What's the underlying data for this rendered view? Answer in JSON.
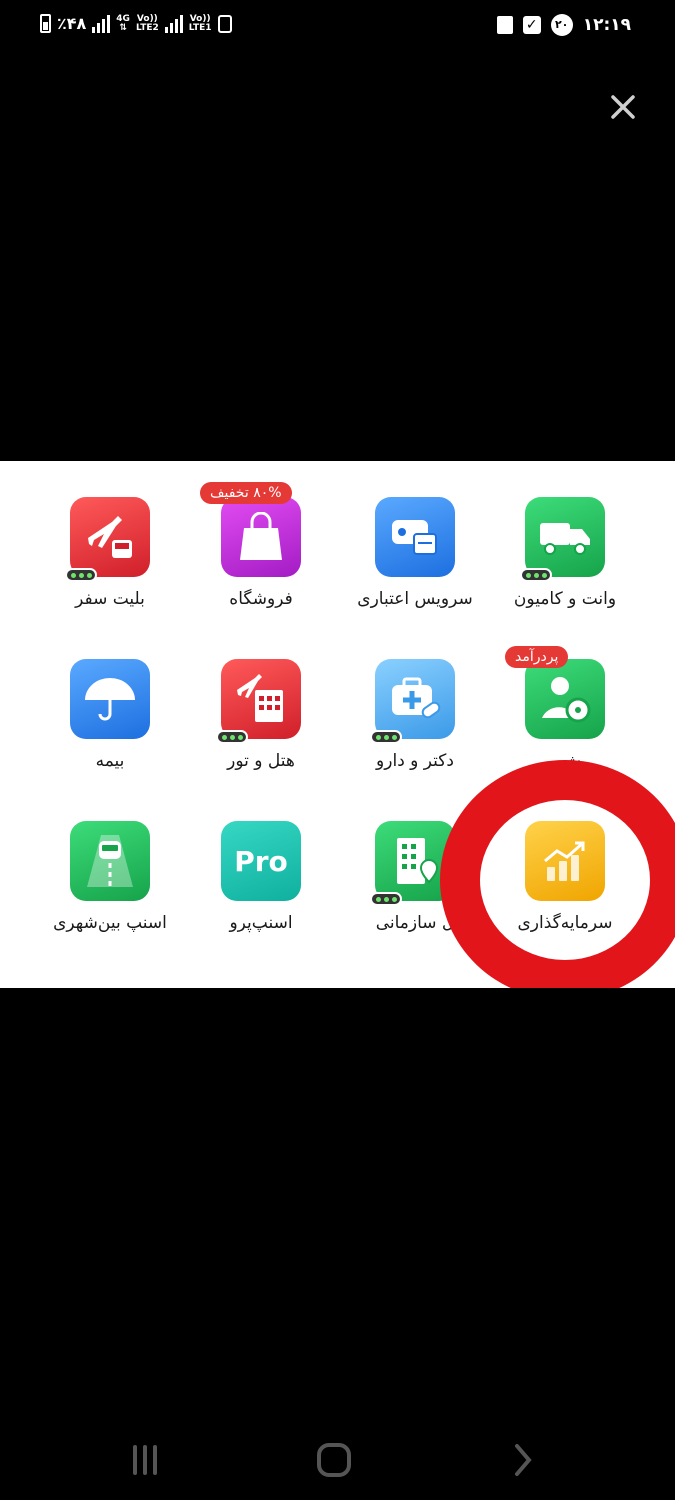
{
  "status_bar": {
    "battery_percent": "٪۴۸",
    "network_1": "4G",
    "network_1_sub": "LTE2",
    "network_2_sub": "LTE1",
    "volte": "Vo))",
    "notification_count": "۲۰",
    "time": "۱۲:۱۹"
  },
  "close_button": {
    "icon": "close-icon"
  },
  "services": [
    {
      "label": "وانت و کامیون",
      "icon": "truck-icon",
      "color": "green",
      "dots": true
    },
    {
      "label": "سرویس اعتباری",
      "icon": "wallet-icon",
      "color": "blue",
      "dots": false
    },
    {
      "label": "فروشگاه",
      "icon": "shopping-bag-icon",
      "color": "purple",
      "dots": false,
      "badge": "۸۰% تخفیف"
    },
    {
      "label": "بلیت سفر",
      "icon": "plane-bus-icon",
      "color": "red",
      "dots": true
    },
    {
      "label": "ث...",
      "icon": "driver-icon",
      "color": "green",
      "dots": false,
      "badge": "پردرآمد"
    },
    {
      "label": "دکتر و دارو",
      "icon": "medical-kit-icon",
      "color": "lightblue",
      "dots": true
    },
    {
      "label": "هتل و تور",
      "icon": "hotel-plane-icon",
      "color": "red",
      "dots": true
    },
    {
      "label": "بیمه",
      "icon": "umbrella-icon",
      "color": "blue",
      "dots": false
    },
    {
      "label": "سرمایه‌گذاری",
      "icon": "chart-up-icon",
      "color": "yellow",
      "dots": false
    },
    {
      "label": "ل سازمانی",
      "icon": "building-location-icon",
      "color": "green",
      "dots": true
    },
    {
      "label": "اسنپ‌پرو",
      "icon": "pro-icon",
      "color": "teal",
      "dots": false,
      "icon_text": "Pro"
    },
    {
      "label": "اسنپ بین‌شهری",
      "icon": "road-car-icon",
      "color": "green",
      "dots": false
    }
  ],
  "highlight": {
    "target": "سرمایه‌گذاری",
    "color": "#e2151b"
  },
  "navigation": {
    "recents": "recents-icon",
    "home": "home-icon",
    "back": "back-icon"
  }
}
